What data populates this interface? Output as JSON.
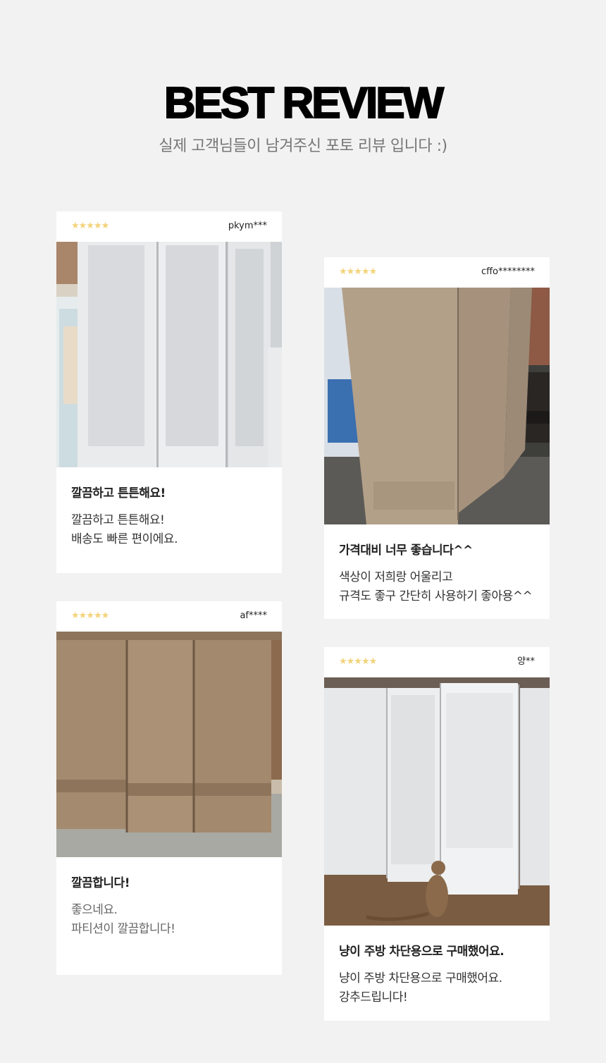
{
  "header": {
    "title": "BEST REVIEW",
    "subtitle": "실제 고객님들이 남겨주신 포토 리뷰 입니다 :)"
  },
  "star_color": "#f3d37a",
  "reviews": [
    {
      "rating": "★★★★★",
      "user": "pkym***",
      "photo": "white folding partition screen next to glass display cabinet",
      "title": "깔끔하고 튼튼해요!",
      "lines": [
        "깔끔하고 튼튼해요!",
        "배송도 빠른 편이에요."
      ]
    },
    {
      "rating": "★★★★★",
      "user": "cffo********",
      "photo": "wood-grain partition screen beside refrigerator and brick wall",
      "title": "가격대비 너무 좋습니다^^",
      "lines": [
        "색상이 저희랑 어울리고",
        "규격도 좋구 간단히 사용하기 좋아용^^"
      ]
    },
    {
      "rating": "★★★★★",
      "user": "af****",
      "photo": "three-panel wood-grain folding partition screen",
      "title": "깔끔합니다!",
      "lines": [
        "좋으네요.",
        "파티션이 깔끔합니다!"
      ]
    },
    {
      "rating": "★★★★★",
      "user": "양**",
      "photo": "white folding partition screen in kitchen with a cat",
      "title": "냥이 주방 차단용으로 구매했어요.",
      "lines": [
        "냥이 주방 차단용으로 구매했어요.",
        "강추드립니다!"
      ]
    }
  ]
}
